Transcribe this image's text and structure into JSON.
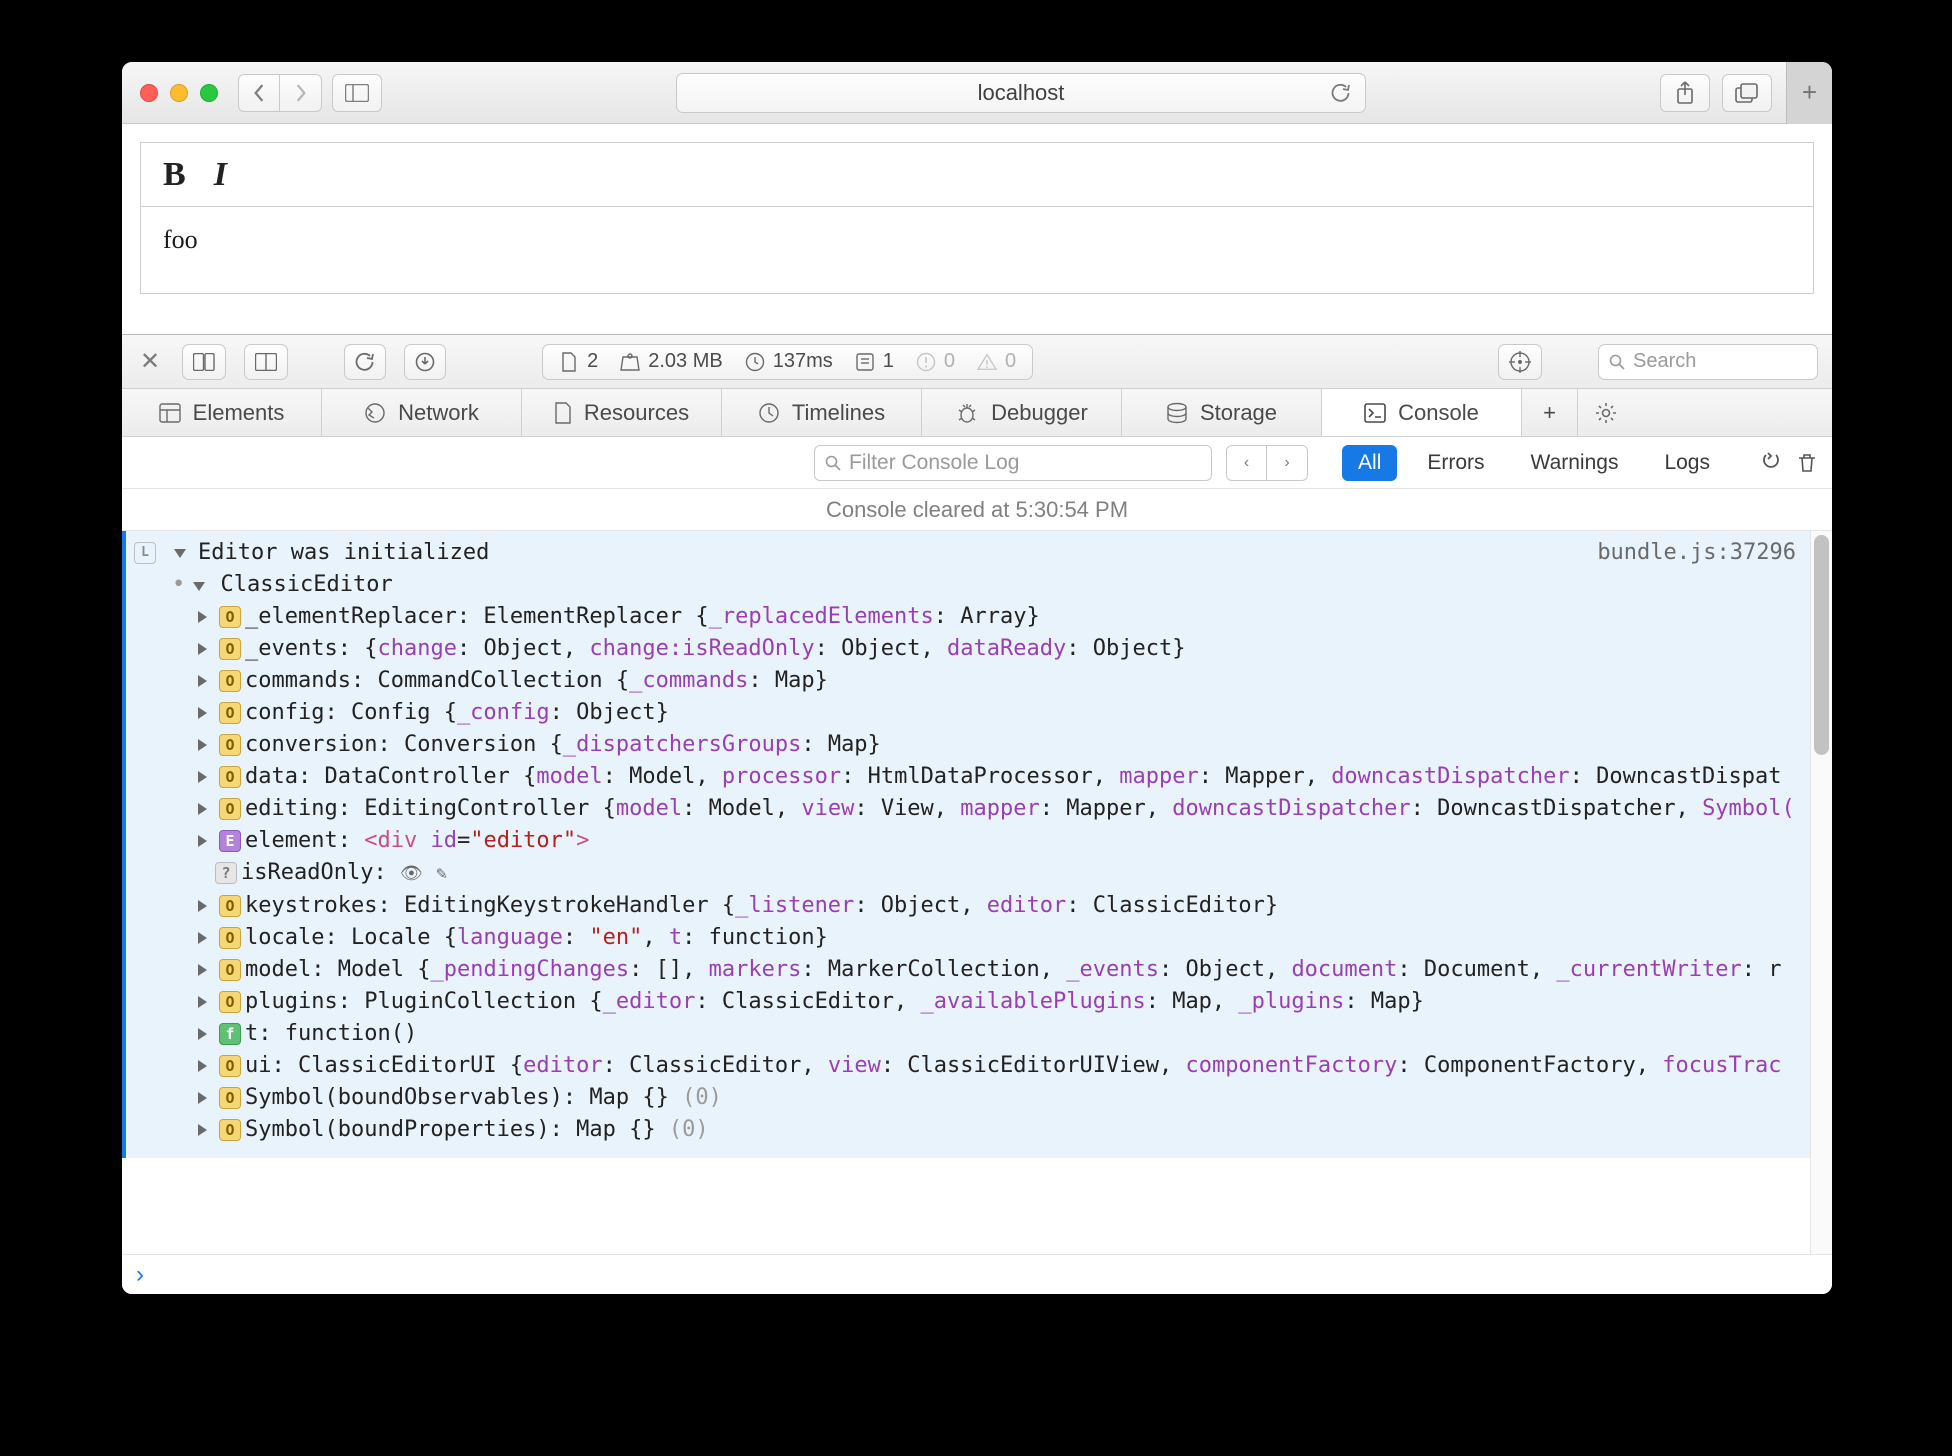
{
  "titlebar": {
    "address": "localhost"
  },
  "editor": {
    "content": "foo"
  },
  "devtools": {
    "stats": {
      "resources": "2",
      "size": "2.03 MB",
      "time": "137ms",
      "logs": "1",
      "errors": "0",
      "warnings": "0"
    },
    "search_placeholder": "Search",
    "tabs": {
      "elements": "Elements",
      "network": "Network",
      "resources": "Resources",
      "timelines": "Timelines",
      "debugger": "Debugger",
      "storage": "Storage",
      "console": "Console"
    },
    "filter": {
      "placeholder": "Filter Console Log",
      "all": "All",
      "errors": "Errors",
      "warnings": "Warnings",
      "logs": "Logs"
    },
    "status": "Console cleared at 5:30:54 PM"
  },
  "log": {
    "title": "Editor was initialized",
    "source": "bundle.js:37296",
    "obj": "ClassicEditor",
    "rows": {
      "elementReplacer": {
        "key": "_elementReplacer:",
        "type": "ElementReplacer ",
        "inner_key": "_replacedElements",
        "inner_val": ": Array}"
      },
      "events": {
        "key": "_events:",
        "pairs": "{change: Object, change:isReadOnly: Object, dataReady: Object}"
      },
      "commands": {
        "key": "commands:",
        "type": "CommandCollection ",
        "inner_key": "_commands",
        "inner_val": ": Map}"
      },
      "config": {
        "key": "config:",
        "type": "Config ",
        "inner_key": "_config",
        "inner_val": ": Object}"
      },
      "conversion": {
        "key": "conversion:",
        "type": "Conversion ",
        "inner_key": "_dispatchersGroups",
        "inner_val": ": Map}"
      },
      "data": {
        "key": "data:",
        "type": "DataController "
      },
      "editing": {
        "key": "editing:",
        "type": "EditingController "
      },
      "element": {
        "key": "element:"
      },
      "isReadOnly": {
        "key": "isReadOnly:"
      },
      "keystrokes": {
        "key": "keystrokes:",
        "type": "EditingKeystrokeHandler "
      },
      "locale": {
        "key": "locale:",
        "type": "Locale "
      },
      "model": {
        "key": "model:",
        "type": "Model "
      },
      "plugins": {
        "key": "plugins:",
        "type": "PluginCollection "
      },
      "t": {
        "key": "t:",
        "val": "function()"
      },
      "ui": {
        "key": "ui:",
        "type": "ClassicEditorUI "
      },
      "sym1": {
        "key": "Symbol(boundObservables):",
        "val": "Map {}",
        "dim": "(0)"
      },
      "sym2": {
        "key": "Symbol(boundProperties):",
        "val": "Map {}",
        "dim": "(0)"
      }
    }
  }
}
